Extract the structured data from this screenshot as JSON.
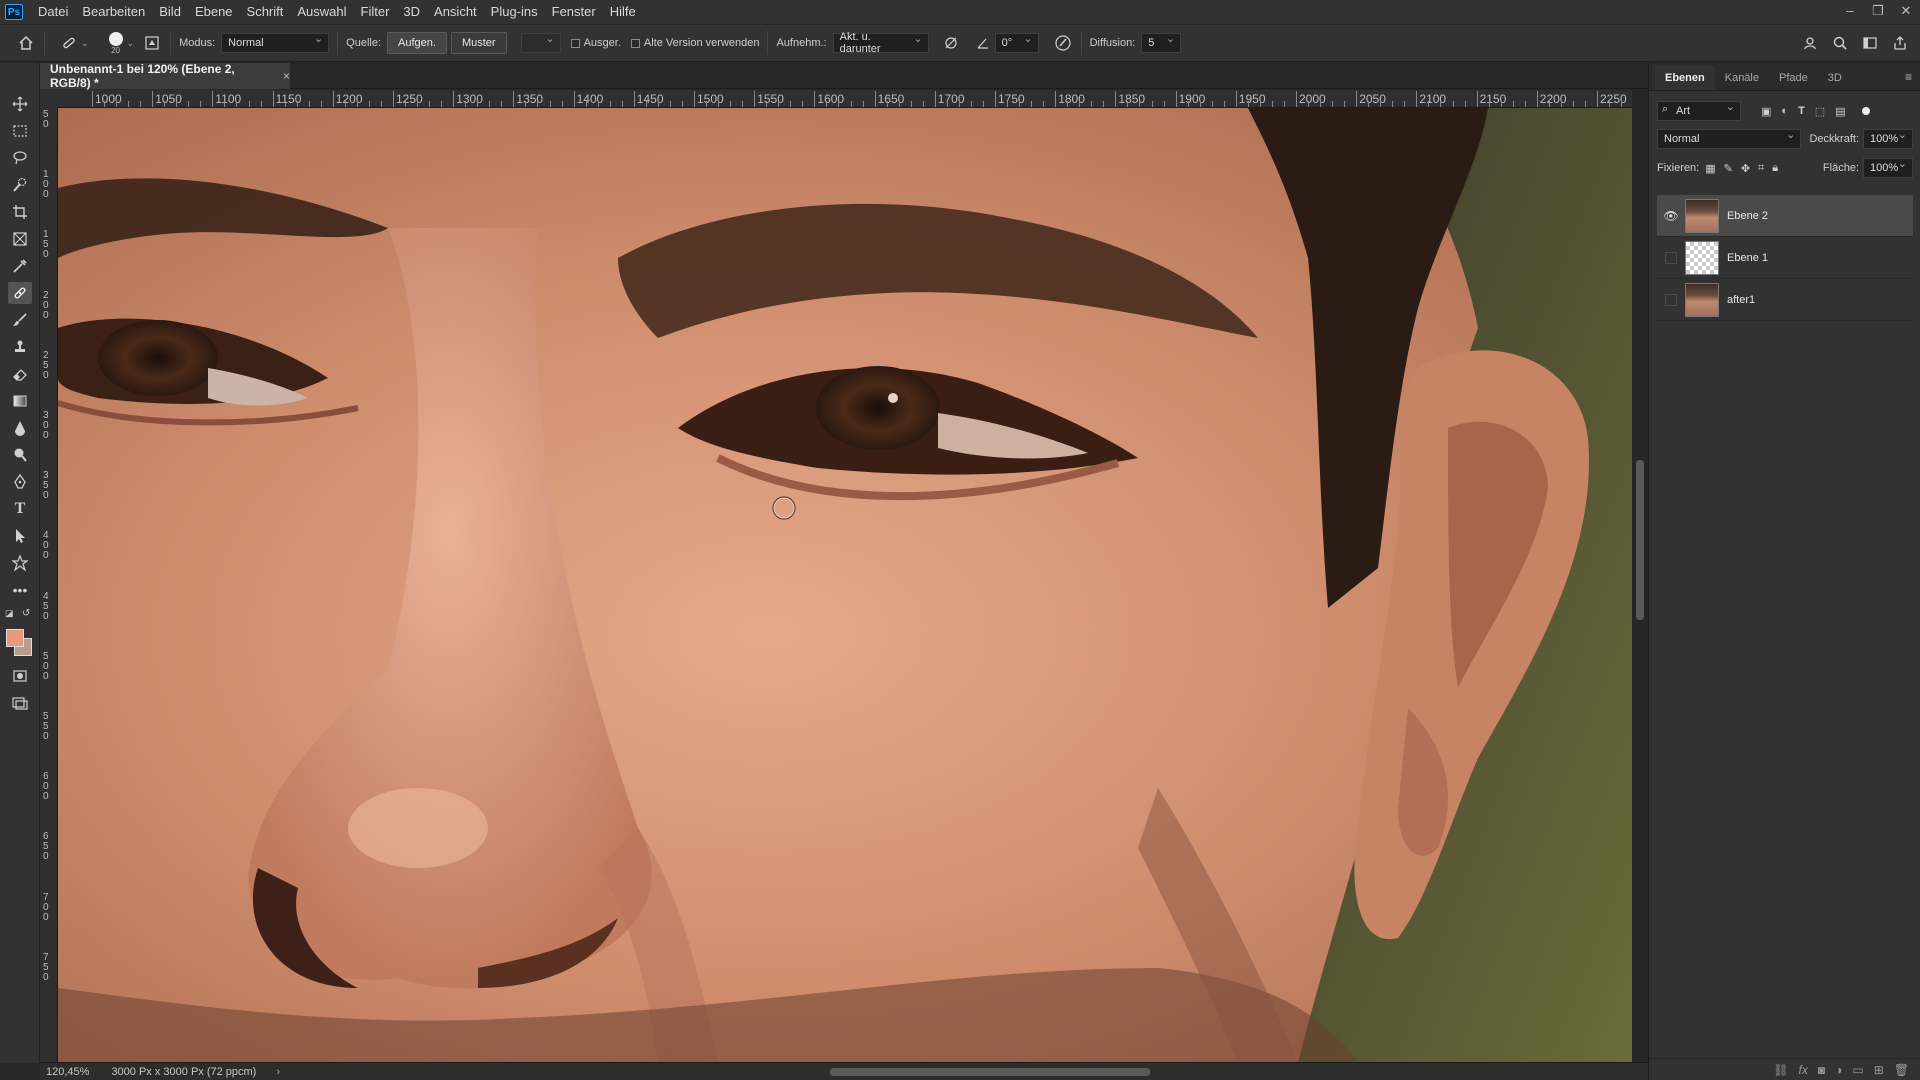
{
  "app": {
    "logo": "Ps",
    "menu": [
      "Datei",
      "Bearbeiten",
      "Bild",
      "Ebene",
      "Schrift",
      "Auswahl",
      "Filter",
      "3D",
      "Ansicht",
      "Plug-ins",
      "Fenster",
      "Hilfe"
    ],
    "window_controls": [
      "–",
      "❐",
      "✕"
    ]
  },
  "options": {
    "brush_size": "20",
    "modus_label": "Modus:",
    "modus_value": "Normal",
    "quelle_label": "Quelle:",
    "aufgen_label": "Aufgen.",
    "muster_label": "Muster",
    "ausger_label": "Ausger.",
    "alte_version_label": "Alte Version verwenden",
    "aufnehm_label": "Aufnehm.:",
    "aufnehm_value": "Akt. u. darunter",
    "angle_value": "0°",
    "diffusion_label": "Diffusion:",
    "diffusion_value": "5"
  },
  "document": {
    "tab_title": "Unbenannt-1 bei 120% (Ebene 2, RGB/8) *",
    "close": "×"
  },
  "ruler": {
    "h_labels": [
      "1000",
      "1050",
      "1100",
      "1150",
      "1200",
      "1250",
      "1300",
      "1350",
      "1400",
      "1450",
      "1500",
      "1550",
      "1600",
      "1650",
      "1700",
      "1750",
      "1800",
      "1850",
      "1900",
      "1950",
      "2000",
      "2050",
      "2100",
      "2150",
      "2200",
      "2250"
    ],
    "v_labels": [
      "50",
      "100",
      "150",
      "200",
      "250",
      "300",
      "350",
      "400",
      "450",
      "500",
      "550",
      "600",
      "650",
      "700",
      "750"
    ]
  },
  "status": {
    "zoom": "120,45%",
    "doc_info": "3000 Px x 3000 Px (72 ppcm)",
    "arrow": "›"
  },
  "panel": {
    "tabs": [
      "Ebenen",
      "Kanäle",
      "Pfade",
      "3D"
    ],
    "filter_label": "Art",
    "blend_mode": "Normal",
    "opacity_label": "Deckkraft:",
    "opacity_value": "100%",
    "lock_label": "Fixieren:",
    "fill_label": "Fläche:",
    "fill_value": "100%",
    "layers": [
      {
        "name": "Ebene 2",
        "visible": true,
        "active": true
      },
      {
        "name": "Ebene 1",
        "visible": false,
        "active": false
      },
      {
        "name": "after1",
        "visible": false,
        "active": false
      }
    ],
    "footer_icons": [
      "link-icon",
      "fx-icon",
      "mask-icon",
      "adjustment-icon",
      "folder-icon",
      "new-layer-icon",
      "trash-icon"
    ]
  },
  "colors": {
    "foreground": "#e59a7c",
    "background": "#ba9a8a",
    "accent": "#31a8ff"
  }
}
